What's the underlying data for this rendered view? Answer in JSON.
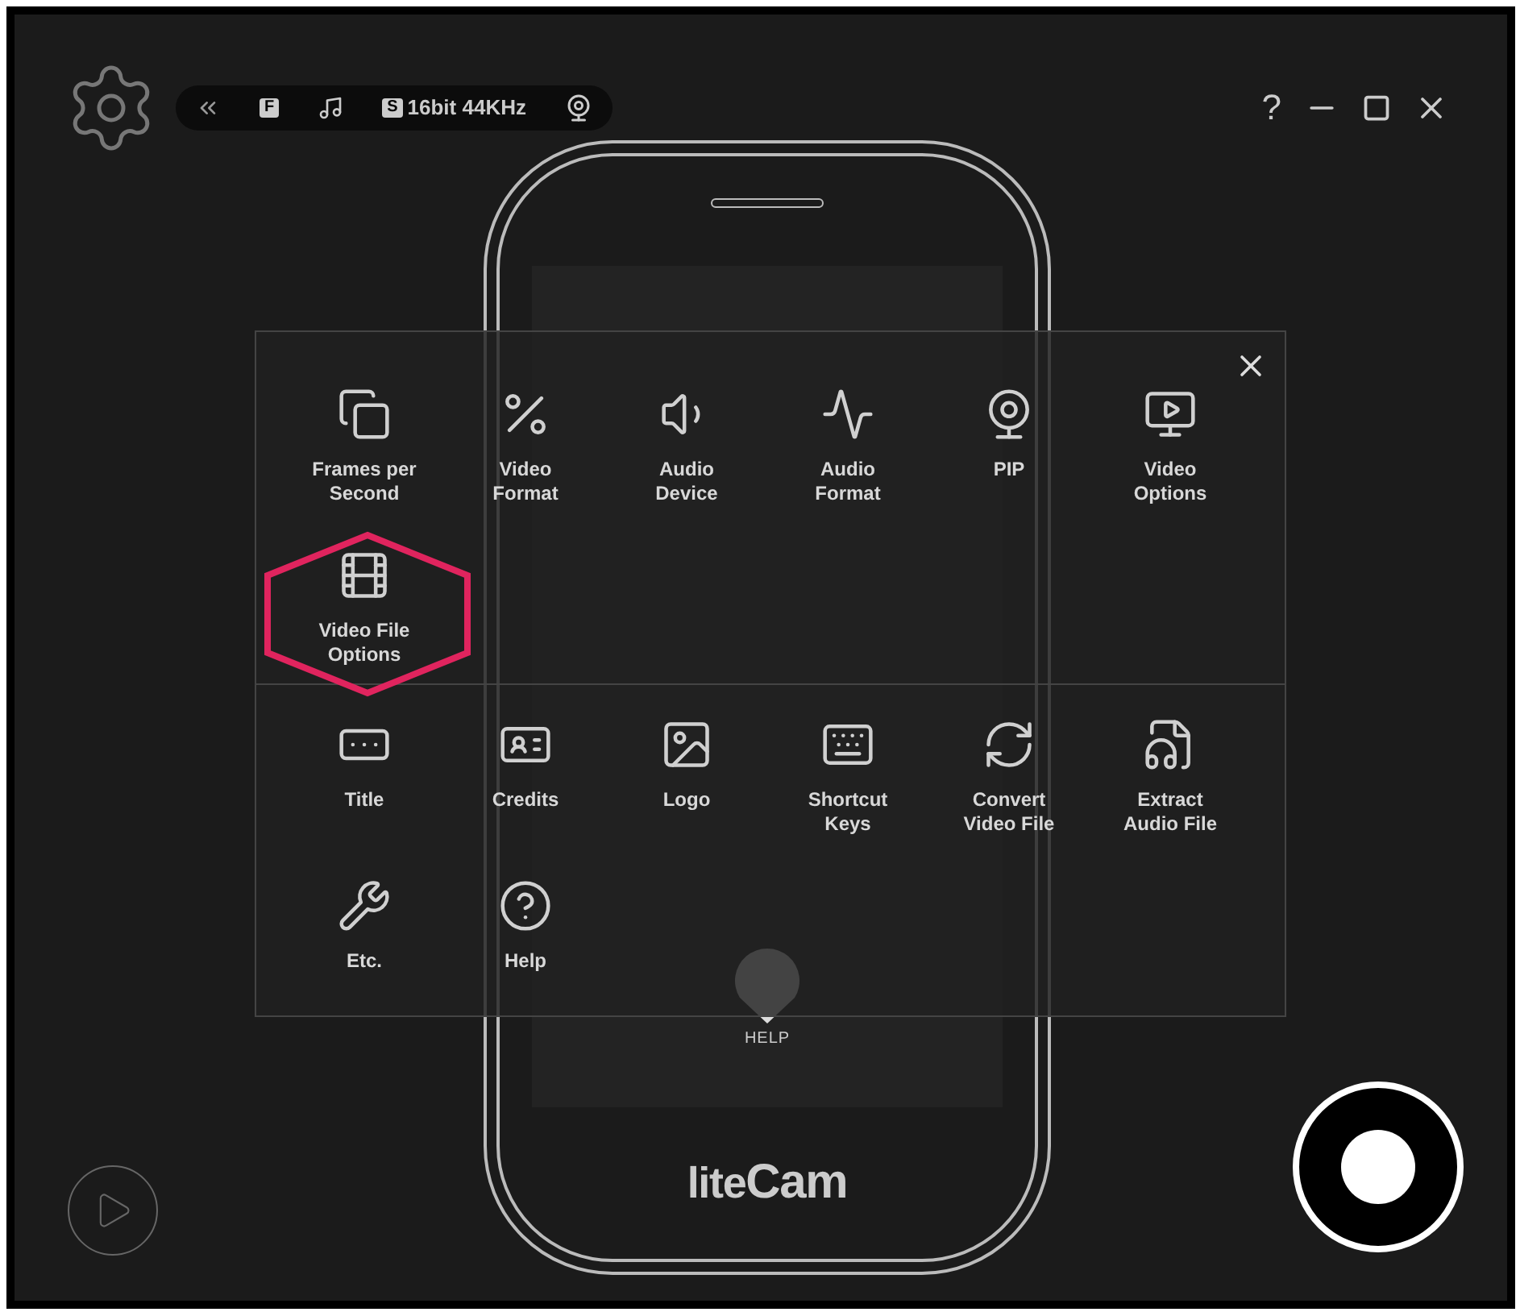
{
  "toolbar": {
    "display_badge": "F",
    "audio_badge": "S",
    "audio_format": "16bit 44KHz"
  },
  "window_controls": {
    "help": "?"
  },
  "phone": {
    "help_label": "HELP",
    "logo_left": "lite",
    "logo_right": "Cam"
  },
  "menu": {
    "sections": [
      {
        "items": [
          {
            "label": "Frames per Second",
            "highlighted": false
          },
          {
            "label": "Video Format",
            "highlighted": false
          },
          {
            "label": "Audio Device",
            "highlighted": false
          },
          {
            "label": "Audio Format",
            "highlighted": false
          },
          {
            "label": "PIP",
            "highlighted": false
          },
          {
            "label": "Video Options",
            "highlighted": false
          },
          {
            "label": "Video File Options",
            "highlighted": true
          }
        ]
      },
      {
        "items": [
          {
            "label": "Title",
            "highlighted": false
          },
          {
            "label": "Credits",
            "highlighted": false
          },
          {
            "label": "Logo",
            "highlighted": false
          },
          {
            "label": "Shortcut Keys",
            "highlighted": false
          },
          {
            "label": "Convert Video File",
            "highlighted": false
          },
          {
            "label": "Extract Audio File",
            "highlighted": false
          },
          {
            "label": "Etc.",
            "highlighted": false
          },
          {
            "label": "Help",
            "highlighted": false
          }
        ]
      }
    ]
  }
}
